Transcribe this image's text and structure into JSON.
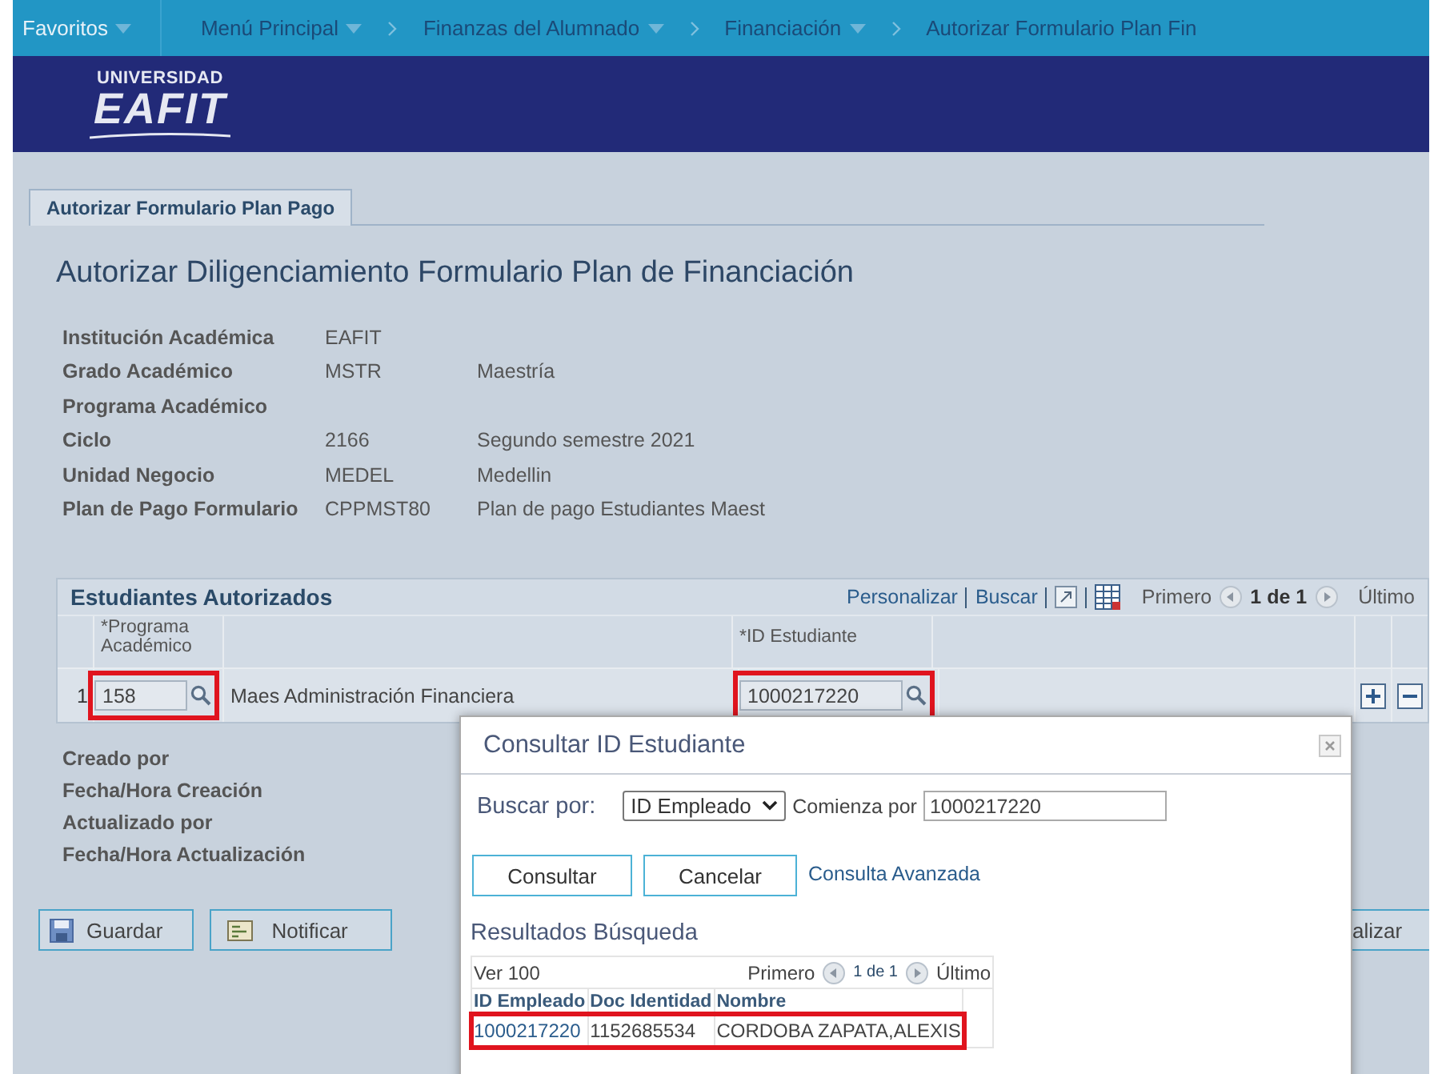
{
  "nav": {
    "items": [
      {
        "label": "Favoritos",
        "dropdown": true
      },
      {
        "label": "Menú Principal",
        "dropdown": true
      },
      {
        "label": "Finanzas del Alumnado",
        "dropdown": true
      },
      {
        "label": "Financiación",
        "dropdown": true
      },
      {
        "label": "Autorizar Formulario Plan Fin",
        "dropdown": false
      }
    ]
  },
  "logo": {
    "line1": "UNIVERSIDAD",
    "line2": "EAFIT"
  },
  "tabs": [
    {
      "label": "Autorizar Formulario Plan Pago",
      "selected": true
    }
  ],
  "page_title": "Autorizar Diligenciamiento Formulario Plan de Financiación",
  "fields": [
    {
      "label": "Institución Académica",
      "code": "EAFIT"
    },
    {
      "label": "Grado Académico",
      "code": "MSTR",
      "description": "Maestría"
    },
    {
      "label": "Programa Académico"
    },
    {
      "label": "Ciclo",
      "code": "2166",
      "description": "Segundo semestre 2021"
    },
    {
      "label": "Unidad Negocio",
      "code": "MEDEL",
      "description": "Medellin"
    },
    {
      "label": "Plan de Pago Formulario",
      "code": "CPPMST80",
      "description": "Plan de pago Estudiantes Maest"
    }
  ],
  "grid": {
    "title": "Estudiantes Autorizados",
    "links": [
      "Personalizar",
      "Buscar"
    ],
    "pager": {
      "first": "Primero",
      "count": "1 de 1",
      "last": "Último"
    },
    "columns": [
      "*Programa Académico",
      "*ID Estudiante"
    ],
    "rows": [
      {
        "number": "1",
        "program": "158",
        "program_name": "Maes Administración Financiera",
        "student_id": "1000217220",
        "highlighted": true
      }
    ]
  },
  "audit_labels": [
    "Creado por",
    "Fecha/Hora Creación",
    "Actualizado por",
    "Fecha/Hora Actualización"
  ],
  "buttons": [
    {
      "label": "Guardar",
      "kind": "save"
    },
    {
      "label": "Notificar",
      "kind": "notify"
    }
  ],
  "partial_button": "alizar",
  "dialog": {
    "title": "Consultar ID Estudiante",
    "search_label": "Buscar por:",
    "search_by": "ID Empleado",
    "operator": "Comienza por",
    "value": "1000217220",
    "buttons": [
      "Consultar",
      "Cancelar"
    ],
    "link": "Consulta Avanzada",
    "results_title": "Resultados Búsqueda",
    "view": "Ver 100",
    "pager": {
      "first": "Primero",
      "count": "1 de 1",
      "last": "Último"
    },
    "columns": [
      "ID Empleado",
      "Doc Identidad",
      "Nombre"
    ],
    "rows": [
      {
        "cells": [
          "1000217220",
          "1152685534",
          "CORDOBA ZAPATA,ALEXIS"
        ],
        "highlighted": true
      }
    ]
  }
}
